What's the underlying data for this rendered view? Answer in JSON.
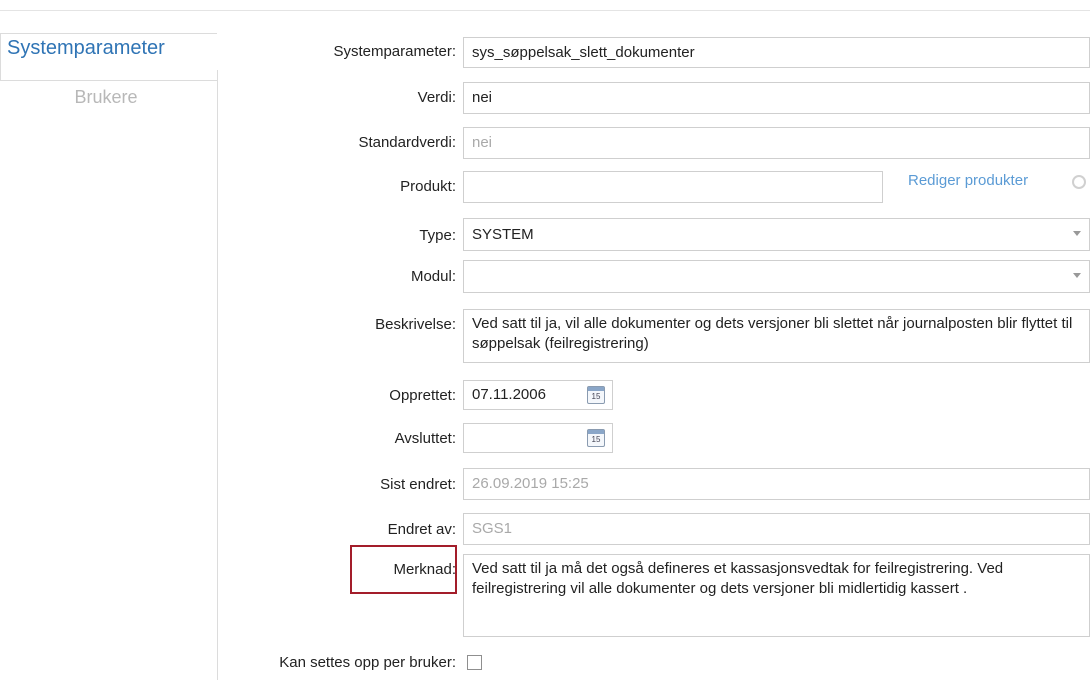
{
  "sidebar": {
    "tabs": [
      {
        "label": "Systemparameter",
        "active": true
      },
      {
        "label": "Brukere",
        "active": false
      }
    ]
  },
  "form": {
    "systemparameter": {
      "label": "Systemparameter:",
      "value": "sys_søppelsak_slett_dokumenter"
    },
    "verdi": {
      "label": "Verdi:",
      "value": "nei"
    },
    "standardverdi": {
      "label": "Standardverdi:",
      "value": "nei"
    },
    "produkt": {
      "label": "Produkt:",
      "value": "",
      "link": "Rediger produkter"
    },
    "type": {
      "label": "Type:",
      "value": "SYSTEM"
    },
    "modul": {
      "label": "Modul:",
      "value": ""
    },
    "beskrivelse": {
      "label": "Beskrivelse:",
      "value": "Ved satt til ja, vil alle dokumenter og dets versjoner bli slettet når journalposten blir flyttet til søppelsak (feilregistrering)"
    },
    "opprettet": {
      "label": "Opprettet:",
      "value": "07.11.2006"
    },
    "avsluttet": {
      "label": "Avsluttet:",
      "value": ""
    },
    "sist_endret": {
      "label": "Sist endret:",
      "value": "26.09.2019 15:25"
    },
    "endret_av": {
      "label": "Endret av:",
      "value": "SGS1"
    },
    "merknad": {
      "label": "Merknad:",
      "value": "Ved satt til ja må det også defineres et kassasjonsvedtak for feilregistrering. Ved feilregistrering vil alle dokumenter og dets versjoner bli midlertidig kassert ."
    },
    "kan_settes": {
      "label": "Kan settes opp per bruker:",
      "checked": false
    }
  },
  "calendar_icon_text": "15",
  "colors": {
    "accent": "#2f74b5",
    "link": "#5b9bd5",
    "highlight": "#a31d2a"
  }
}
